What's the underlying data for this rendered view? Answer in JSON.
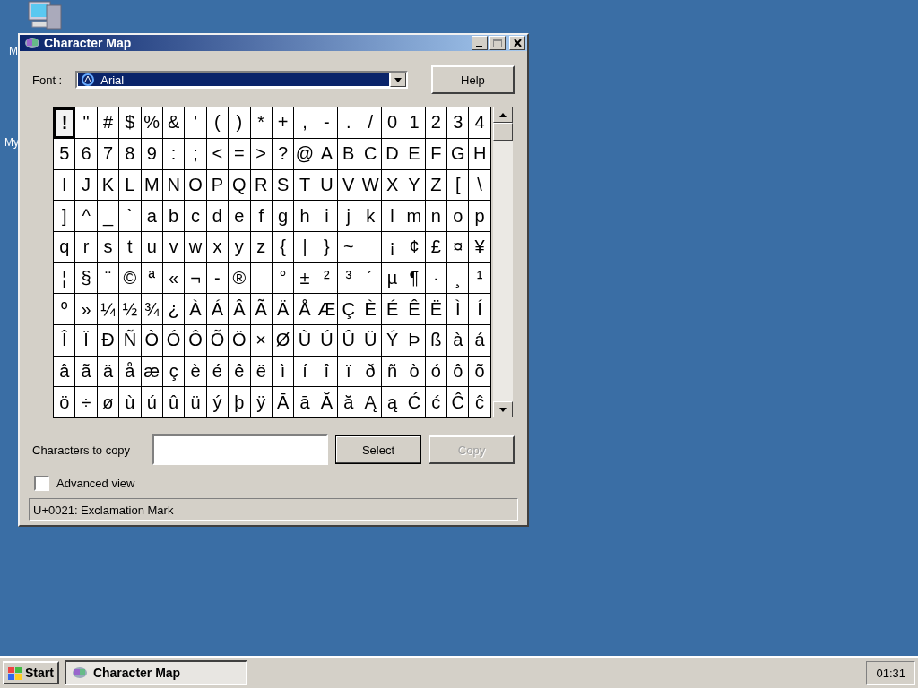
{
  "desktop": {
    "icons": [
      {
        "label": "M"
      },
      {
        "label": "My"
      }
    ]
  },
  "window": {
    "title": "Character Map"
  },
  "font": {
    "label": "Font :",
    "value": "Arial"
  },
  "help_button": {
    "label": "Help"
  },
  "characters": [
    {
      "char": "!",
      "selected": true
    },
    {
      "char": "\"",
      "selected": false
    },
    {
      "char": "#",
      "selected": false
    },
    {
      "char": "$",
      "selected": false
    },
    {
      "char": "%",
      "selected": false
    },
    {
      "char": "&",
      "selected": false
    },
    {
      "char": "'",
      "selected": false
    },
    {
      "char": "(",
      "selected": false
    },
    {
      "char": ")",
      "selected": false
    },
    {
      "char": "*",
      "selected": false
    },
    {
      "char": "+",
      "selected": false
    },
    {
      "char": ",",
      "selected": false
    },
    {
      "char": "-",
      "selected": false
    },
    {
      "char": ".",
      "selected": false
    },
    {
      "char": "/",
      "selected": false
    },
    {
      "char": "0",
      "selected": false
    },
    {
      "char": "1",
      "selected": false
    },
    {
      "char": "2",
      "selected": false
    },
    {
      "char": "3",
      "selected": false
    },
    {
      "char": "4",
      "selected": false
    },
    {
      "char": "5",
      "selected": false
    },
    {
      "char": "6",
      "selected": false
    },
    {
      "char": "7",
      "selected": false
    },
    {
      "char": "8",
      "selected": false
    },
    {
      "char": "9",
      "selected": false
    },
    {
      "char": ":",
      "selected": false
    },
    {
      "char": ";",
      "selected": false
    },
    {
      "char": "<",
      "selected": false
    },
    {
      "char": "=",
      "selected": false
    },
    {
      "char": ">",
      "selected": false
    },
    {
      "char": "?",
      "selected": false
    },
    {
      "char": "@",
      "selected": false
    },
    {
      "char": "A",
      "selected": false
    },
    {
      "char": "B",
      "selected": false
    },
    {
      "char": "C",
      "selected": false
    },
    {
      "char": "D",
      "selected": false
    },
    {
      "char": "E",
      "selected": false
    },
    {
      "char": "F",
      "selected": false
    },
    {
      "char": "G",
      "selected": false
    },
    {
      "char": "H",
      "selected": false
    },
    {
      "char": "I",
      "selected": false
    },
    {
      "char": "J",
      "selected": false
    },
    {
      "char": "K",
      "selected": false
    },
    {
      "char": "L",
      "selected": false
    },
    {
      "char": "M",
      "selected": false
    },
    {
      "char": "N",
      "selected": false
    },
    {
      "char": "O",
      "selected": false
    },
    {
      "char": "P",
      "selected": false
    },
    {
      "char": "Q",
      "selected": false
    },
    {
      "char": "R",
      "selected": false
    },
    {
      "char": "S",
      "selected": false
    },
    {
      "char": "T",
      "selected": false
    },
    {
      "char": "U",
      "selected": false
    },
    {
      "char": "V",
      "selected": false
    },
    {
      "char": "W",
      "selected": false
    },
    {
      "char": "X",
      "selected": false
    },
    {
      "char": "Y",
      "selected": false
    },
    {
      "char": "Z",
      "selected": false
    },
    {
      "char": "[",
      "selected": false
    },
    {
      "char": "\\",
      "selected": false
    },
    {
      "char": "]",
      "selected": false
    },
    {
      "char": "^",
      "selected": false
    },
    {
      "char": "_",
      "selected": false
    },
    {
      "char": "`",
      "selected": false
    },
    {
      "char": "a",
      "selected": false
    },
    {
      "char": "b",
      "selected": false
    },
    {
      "char": "c",
      "selected": false
    },
    {
      "char": "d",
      "selected": false
    },
    {
      "char": "e",
      "selected": false
    },
    {
      "char": "f",
      "selected": false
    },
    {
      "char": "g",
      "selected": false
    },
    {
      "char": "h",
      "selected": false
    },
    {
      "char": "i",
      "selected": false
    },
    {
      "char": "j",
      "selected": false
    },
    {
      "char": "k",
      "selected": false
    },
    {
      "char": "l",
      "selected": false
    },
    {
      "char": "m",
      "selected": false
    },
    {
      "char": "n",
      "selected": false
    },
    {
      "char": "o",
      "selected": false
    },
    {
      "char": "p",
      "selected": false
    },
    {
      "char": "q",
      "selected": false
    },
    {
      "char": "r",
      "selected": false
    },
    {
      "char": "s",
      "selected": false
    },
    {
      "char": "t",
      "selected": false
    },
    {
      "char": "u",
      "selected": false
    },
    {
      "char": "v",
      "selected": false
    },
    {
      "char": "w",
      "selected": false
    },
    {
      "char": "x",
      "selected": false
    },
    {
      "char": "y",
      "selected": false
    },
    {
      "char": "z",
      "selected": false
    },
    {
      "char": "{",
      "selected": false
    },
    {
      "char": "|",
      "selected": false
    },
    {
      "char": "}",
      "selected": false
    },
    {
      "char": "~",
      "selected": false
    },
    {
      "selected": false
    },
    {
      "char": "¡",
      "selected": false
    },
    {
      "char": "¢",
      "selected": false
    },
    {
      "char": "£",
      "selected": false
    },
    {
      "char": "¤",
      "selected": false
    },
    {
      "char": "¥",
      "selected": false
    },
    {
      "char": "¦",
      "selected": false
    },
    {
      "char": "§",
      "selected": false
    },
    {
      "char": "¨",
      "selected": false
    },
    {
      "char": "©",
      "selected": false
    },
    {
      "char": "ª",
      "selected": false
    },
    {
      "char": "«",
      "selected": false
    },
    {
      "char": "¬",
      "selected": false
    },
    {
      "char": "-",
      "selected": false
    },
    {
      "char": "®",
      "selected": false
    },
    {
      "char": "¯",
      "selected": false
    },
    {
      "char": "°",
      "selected": false
    },
    {
      "char": "±",
      "selected": false
    },
    {
      "char": "²",
      "selected": false
    },
    {
      "char": "³",
      "selected": false
    },
    {
      "char": "´",
      "selected": false
    },
    {
      "char": "µ",
      "selected": false
    },
    {
      "char": "¶",
      "selected": false
    },
    {
      "char": "·",
      "selected": false
    },
    {
      "char": "¸",
      "selected": false
    },
    {
      "char": "¹",
      "selected": false
    },
    {
      "char": "º",
      "selected": false
    },
    {
      "char": "»",
      "selected": false
    },
    {
      "char": "¼",
      "selected": false
    },
    {
      "char": "½",
      "selected": false
    },
    {
      "char": "¾",
      "selected": false
    },
    {
      "char": "¿",
      "selected": false
    },
    {
      "char": "À",
      "selected": false
    },
    {
      "char": "Á",
      "selected": false
    },
    {
      "char": "Â",
      "selected": false
    },
    {
      "char": "Ã",
      "selected": false
    },
    {
      "char": "Ä",
      "selected": false
    },
    {
      "char": "Å",
      "selected": false
    },
    {
      "char": "Æ",
      "selected": false
    },
    {
      "char": "Ç",
      "selected": false
    },
    {
      "char": "È",
      "selected": false
    },
    {
      "char": "É",
      "selected": false
    },
    {
      "char": "Ê",
      "selected": false
    },
    {
      "char": "Ë",
      "selected": false
    },
    {
      "char": "Ì",
      "selected": false
    },
    {
      "char": "Í",
      "selected": false
    },
    {
      "char": "Î",
      "selected": false
    },
    {
      "char": "Ï",
      "selected": false
    },
    {
      "char": "Ð",
      "selected": false
    },
    {
      "char": "Ñ",
      "selected": false
    },
    {
      "char": "Ò",
      "selected": false
    },
    {
      "char": "Ó",
      "selected": false
    },
    {
      "char": "Ô",
      "selected": false
    },
    {
      "char": "Õ",
      "selected": false
    },
    {
      "char": "Ö",
      "selected": false
    },
    {
      "char": "×",
      "selected": false
    },
    {
      "char": "Ø",
      "selected": false
    },
    {
      "char": "Ù",
      "selected": false
    },
    {
      "char": "Ú",
      "selected": false
    },
    {
      "char": "Û",
      "selected": false
    },
    {
      "char": "Ü",
      "selected": false
    },
    {
      "char": "Ý",
      "selected": false
    },
    {
      "char": "Þ",
      "selected": false
    },
    {
      "char": "ß",
      "selected": false
    },
    {
      "char": "à",
      "selected": false
    },
    {
      "char": "á",
      "selected": false
    },
    {
      "char": "â",
      "selected": false
    },
    {
      "char": "ã",
      "selected": false
    },
    {
      "char": "ä",
      "selected": false
    },
    {
      "char": "å",
      "selected": false
    },
    {
      "char": "æ",
      "selected": false
    },
    {
      "char": "ç",
      "selected": false
    },
    {
      "char": "è",
      "selected": false
    },
    {
      "char": "é",
      "selected": false
    },
    {
      "char": "ê",
      "selected": false
    },
    {
      "char": "ë",
      "selected": false
    },
    {
      "char": "ì",
      "selected": false
    },
    {
      "char": "í",
      "selected": false
    },
    {
      "char": "î",
      "selected": false
    },
    {
      "char": "ï",
      "selected": false
    },
    {
      "char": "ð",
      "selected": false
    },
    {
      "char": "ñ",
      "selected": false
    },
    {
      "char": "ò",
      "selected": false
    },
    {
      "char": "ó",
      "selected": false
    },
    {
      "char": "ô",
      "selected": false
    },
    {
      "char": "õ",
      "selected": false
    },
    {
      "char": "ö",
      "selected": false
    },
    {
      "char": "÷",
      "selected": false
    },
    {
      "char": "ø",
      "selected": false
    },
    {
      "char": "ù",
      "selected": false
    },
    {
      "char": "ú",
      "selected": false
    },
    {
      "char": "û",
      "selected": false
    },
    {
      "char": "ü",
      "selected": false
    },
    {
      "char": "ý",
      "selected": false
    },
    {
      "char": "þ",
      "selected": false
    },
    {
      "char": "ÿ",
      "selected": false
    },
    {
      "char": "Ā",
      "selected": false
    },
    {
      "char": "ā",
      "selected": false
    },
    {
      "char": "Ă",
      "selected": false
    },
    {
      "char": "ă",
      "selected": false
    },
    {
      "char": "Ą",
      "selected": false
    },
    {
      "char": "ą",
      "selected": false
    },
    {
      "char": "Ć",
      "selected": false
    },
    {
      "char": "ć",
      "selected": false
    },
    {
      "char": "Ĉ",
      "selected": false
    },
    {
      "char": "ĉ",
      "selected": false
    }
  ],
  "copy_field": {
    "label": "Characters to copy"
  },
  "buttons": [
    {
      "label": "Select",
      "disabled": false
    },
    {
      "label": "Copy",
      "disabled": true
    }
  ],
  "advanced_view": {
    "label": "Advanced view",
    "checked": false
  },
  "status_bar": "U+0021: Exclamation Mark",
  "taskbar": {
    "start": "Start",
    "tasks": [
      {
        "label": "Character Map",
        "selected": false
      }
    ],
    "clock": "01:31"
  }
}
